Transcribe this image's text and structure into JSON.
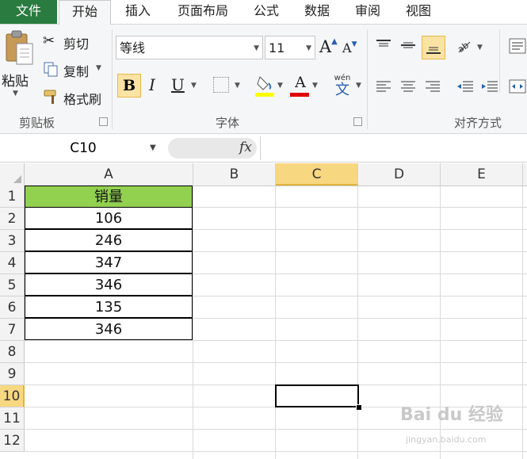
{
  "tabs": {
    "file": "文件",
    "home": "开始",
    "insert": "插入",
    "page_layout": "页面布局",
    "formulas": "公式",
    "data": "数据",
    "review": "审阅",
    "view": "视图"
  },
  "clipboard": {
    "paste": "粘贴",
    "cut": "剪切",
    "copy": "复制",
    "format_painter": "格式刷",
    "group_label": "剪贴板"
  },
  "font": {
    "name": "等线",
    "size": "11",
    "bold": "B",
    "italic": "I",
    "underline": "U",
    "font_color_letter": "A",
    "grow_letter": "A",
    "shrink_letter": "A",
    "phonetic": "wén",
    "phonetic_char": "文",
    "group_label": "字体",
    "fill_color": "#ffff00",
    "font_color": "#e00000"
  },
  "alignment": {
    "group_label": "对齐方式"
  },
  "formula_bar": {
    "name_box": "C10",
    "fx": "fx",
    "value": ""
  },
  "sheet": {
    "columns": [
      "A",
      "B",
      "C",
      "D",
      "E"
    ],
    "rows": [
      "1",
      "2",
      "3",
      "4",
      "5",
      "6",
      "7",
      "8",
      "9",
      "10",
      "11",
      "12"
    ],
    "active_column": "C",
    "active_row": "10",
    "column_a": [
      "销量",
      "106",
      "246",
      "347",
      "346",
      "135",
      "346"
    ],
    "header_fill": "#92d050"
  },
  "watermark": {
    "text": "Bai du 经验",
    "sub": "jingyan.baidu.com"
  }
}
